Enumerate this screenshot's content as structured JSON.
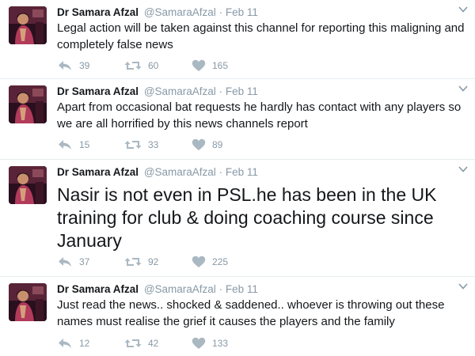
{
  "colors": {
    "text": "#14171a",
    "muted": "#8899a6",
    "divider": "#e6ecf0",
    "icon": "#aab8c2"
  },
  "tweets": [
    {
      "name": "Dr Samara Afzal",
      "handle": "@SamaraAfzal",
      "separator": "·",
      "date": "Feb 11",
      "text": "Legal action will be taken against this channel for reporting this maligning and completely false news",
      "replies": "39",
      "retweets": "60",
      "likes": "165",
      "icons": {
        "reply": "reply-icon",
        "retweet": "retweet-icon",
        "like": "heart-icon",
        "menu": "chevron-down-icon"
      }
    },
    {
      "name": "Dr Samara Afzal",
      "handle": "@SamaraAfzal",
      "separator": "·",
      "date": "Feb 11",
      "text": "Apart from occasional bat requests he hardly has contact with any players so we are all horrified by this news channels report",
      "replies": "15",
      "retweets": "33",
      "likes": "89",
      "icons": {
        "reply": "reply-icon",
        "retweet": "retweet-icon",
        "like": "heart-icon",
        "menu": "chevron-down-icon"
      }
    },
    {
      "name": "Dr Samara Afzal",
      "handle": "@SamaraAfzal",
      "separator": "·",
      "date": "Feb 11",
      "text": "Nasir is not even in PSL.he has been in the UK training for club & doing coaching course since January",
      "replies": "37",
      "retweets": "92",
      "likes": "225",
      "icons": {
        "reply": "reply-icon",
        "retweet": "retweet-icon",
        "like": "heart-icon",
        "menu": "chevron-down-icon"
      }
    },
    {
      "name": "Dr Samara Afzal",
      "handle": "@SamaraAfzal",
      "separator": "·",
      "date": "Feb 11",
      "text": "Just read the news.. shocked & saddened.. whoever is throwing out these names must realise the grief it causes the players and the family",
      "replies": "12",
      "retweets": "42",
      "likes": "133",
      "icons": {
        "reply": "reply-icon",
        "retweet": "retweet-icon",
        "like": "heart-icon",
        "menu": "chevron-down-icon"
      }
    }
  ]
}
